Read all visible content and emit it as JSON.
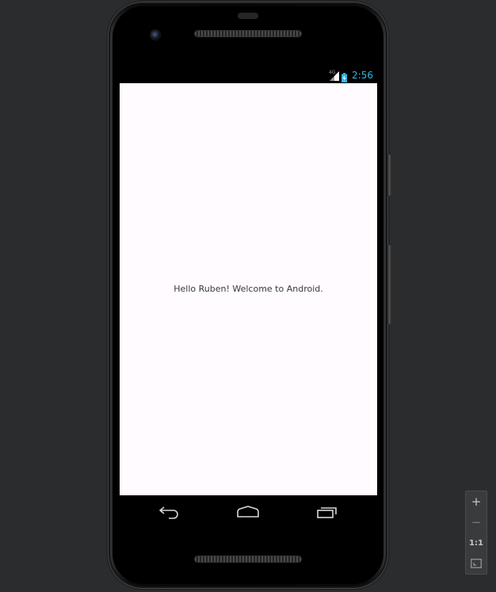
{
  "status_bar": {
    "network": "4G",
    "time": "2:56",
    "clock_color": "#33b5e5"
  },
  "app": {
    "message": "Hello Ruben! Welcome to Android.",
    "background": "#fffbfe"
  },
  "nav_bar": {
    "buttons": [
      "back-icon",
      "home-icon",
      "recent-apps-icon"
    ]
  },
  "zoom_controls": {
    "zoom_in": "+",
    "zoom_out": "−",
    "actual_size": "1:1",
    "fit_icon": "fit-screen-icon"
  }
}
